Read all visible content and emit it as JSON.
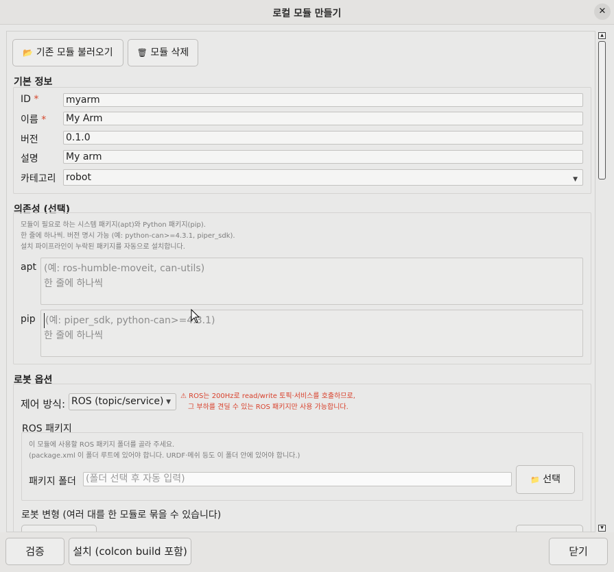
{
  "window": {
    "title": "로컬 모듈 만들기",
    "close_glyph": "✕"
  },
  "top_buttons": {
    "load": {
      "icon": "📂",
      "label": "기존 모듈 불러오기"
    },
    "delete": {
      "icon": "🗑",
      "label": "모듈 삭제"
    }
  },
  "basic": {
    "title": "기본 정보",
    "id": {
      "label": "ID",
      "required": "*",
      "value": "myarm"
    },
    "name": {
      "label": "이름",
      "required": "*",
      "value": "My Arm"
    },
    "version": {
      "label": "버전",
      "value": "0.1.0"
    },
    "desc": {
      "label": "설명",
      "value": "My arm"
    },
    "category": {
      "label": "카테고리",
      "value": "robot"
    }
  },
  "deps": {
    "title": "의존성 (선택)",
    "help": [
      "모듈이 필요로 하는 시스템 패키지(apt)와 Python 패키지(pip).",
      "한 줄에 하나씩. 버전 명시 가능 (예: python-can>=4.3.1, piper_sdk).",
      "설치 파이프라인이 누락된 패키지를 자동으로 설치합니다."
    ],
    "apt": {
      "label": "apt",
      "placeholder_l1": "(예: ros-humble-moveit, can-utils)",
      "placeholder_l2": "한 줄에 하나씩"
    },
    "pip": {
      "label": "pip",
      "placeholder_l1": "(예: piper_sdk, python-can>=4.3.1)",
      "placeholder_l2": "한 줄에 하나씩"
    }
  },
  "robot": {
    "title": "로봇 옵션",
    "control_label": "제어 방식:",
    "control_value": "ROS (topic/service)",
    "warning_l1": "⚠ ROS는 200Hz로 read/write 토픽·서비스를 호출하므로,",
    "warning_l2": "그 부하를 견딜 수 있는 ROS 패키지만 사용 가능합니다.",
    "ros_pkg_title": "ROS 패키지",
    "ros_help_l1": "이 모듈에 사용할 ROS 패키지 폴더를 골라 주세요.",
    "ros_help_l2": "(package.xml 이 폴더 루트에 있어야 합니다. URDF·메쉬 등도 이 폴더 안에 있어야 합니다.)",
    "pkg_folder_label": "패키지 폴더",
    "pkg_folder_placeholder": "(폴더 선택 후 자동 입력)",
    "select_btn": {
      "icon": "📁",
      "label": "선택"
    },
    "variants_title": "로봇 변형 (여러 대를 한 모듈로 묶을 수 있습니다)"
  },
  "bottom_buttons": {
    "validate": "검증",
    "install": "설치 (colcon build 포함)",
    "close": "닫기"
  },
  "colors": {
    "accent_required": "#d4452a",
    "warning": "#d8402b",
    "window_bg": "#e8e8e7"
  }
}
